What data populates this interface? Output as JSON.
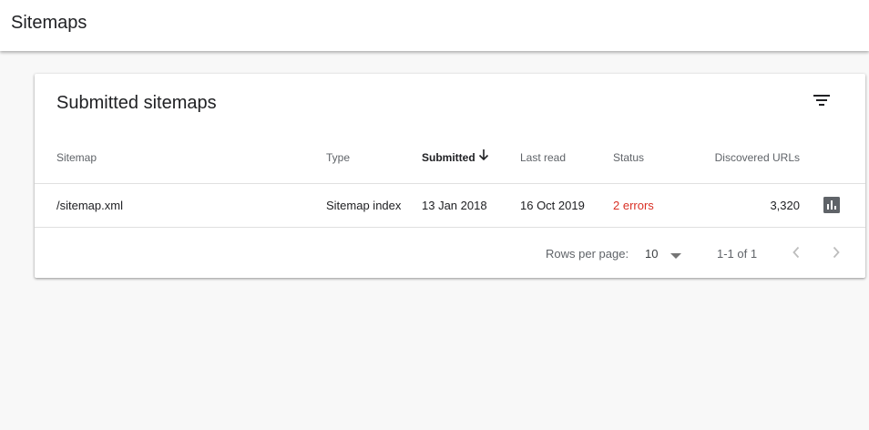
{
  "page": {
    "title": "Sitemaps"
  },
  "card": {
    "title": "Submitted sitemaps",
    "filter_icon": "filter-list-icon"
  },
  "table": {
    "columns": [
      {
        "label": "Sitemap"
      },
      {
        "label": "Type"
      },
      {
        "label": "Submitted",
        "sorted": "descending"
      },
      {
        "label": "Last read"
      },
      {
        "label": "Status"
      },
      {
        "label": "Discovered URLs"
      }
    ],
    "rows": [
      {
        "sitemap": "/sitemap.xml",
        "type": "Sitemap index",
        "submitted": "13 Jan 2018",
        "last_read": "16 Oct 2019",
        "status": "2 errors",
        "discovered_urls": "3,320",
        "action_icon": "bar-chart-icon"
      }
    ]
  },
  "pagination": {
    "rows_per_page_label": "Rows per page:",
    "rows_per_page_value": "10",
    "range": "1-1 of 1",
    "prev_icon": "chevron-left-icon",
    "next_icon": "chevron-right-icon"
  },
  "colors": {
    "error": "#d93025",
    "background": "#f8f8f8",
    "card": "#ffffff"
  }
}
